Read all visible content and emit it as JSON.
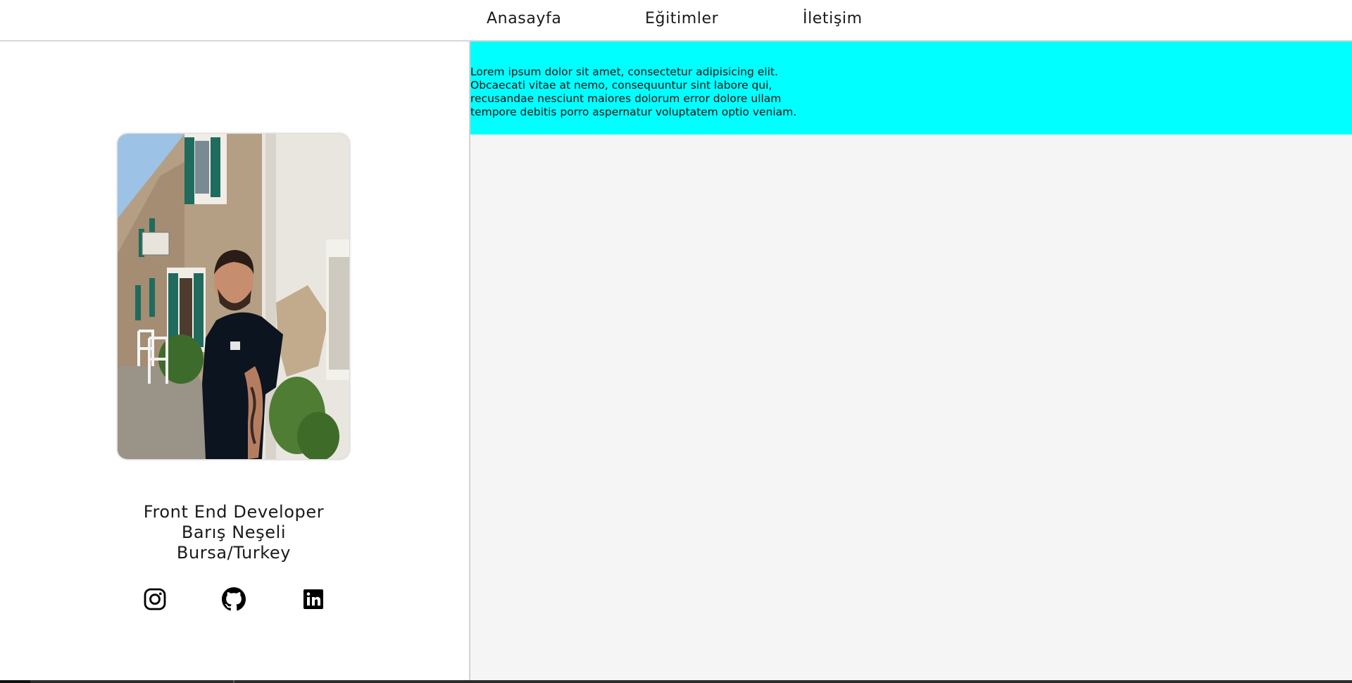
{
  "nav": {
    "home": "Anasayfa",
    "education": "Eğitimler",
    "contact": "İletişim"
  },
  "profile": {
    "role": "Front End Developer",
    "name": "Barış Neşeli",
    "location": "Bursa/Turkey"
  },
  "social": {
    "icons": [
      "instagram-icon",
      "github-icon",
      "linkedin-icon"
    ]
  },
  "banner": {
    "text": "Lorem ipsum dolor sit amet, consectetur adipisicing elit. Obcaecati vitae at nemo, consequuntur sint labore qui, recusandae nesciunt maiores dolorum error dolore ullam tempore debitis porro aspernatur voluptatem optio veniam.",
    "background": "#00ffff"
  },
  "colors": {
    "main_background": "#f5f5f5",
    "text": "#1a1a1a"
  }
}
